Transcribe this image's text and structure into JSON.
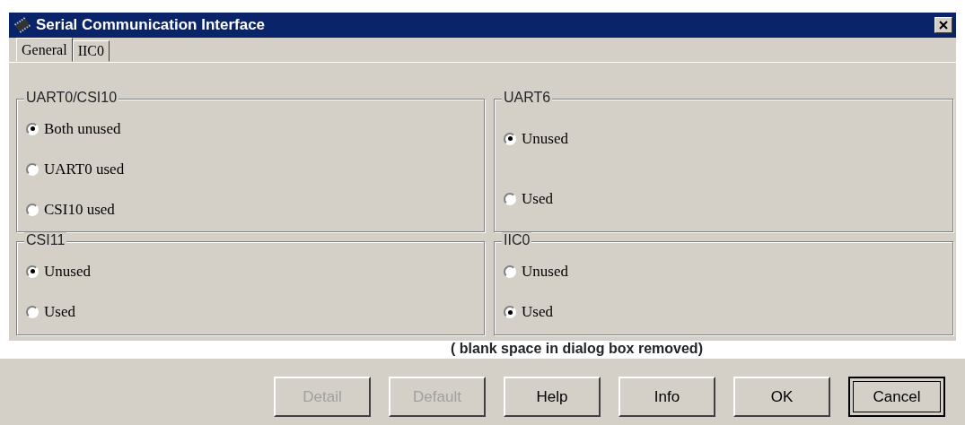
{
  "window": {
    "title": "Serial Communication Interface"
  },
  "tabs": [
    {
      "label": "General",
      "selected": true
    },
    {
      "label": "IIC0",
      "selected": false
    }
  ],
  "groups": [
    {
      "title": "UART0/CSI10",
      "options": [
        {
          "label": "Both unused",
          "selected": true
        },
        {
          "label": "UART0 used",
          "selected": false
        },
        {
          "label": "CSI10 used",
          "selected": false
        }
      ]
    },
    {
      "title": "UART6",
      "options": [
        {
          "label": "Unused",
          "selected": true
        },
        {
          "label": "Used",
          "selected": false
        }
      ]
    },
    {
      "title": "CSI11",
      "options": [
        {
          "label": "Unused",
          "selected": true
        },
        {
          "label": "Used",
          "selected": false
        }
      ]
    },
    {
      "title": "IIC0",
      "options": [
        {
          "label": "Unused",
          "selected": false
        },
        {
          "label": "Used",
          "selected": true
        }
      ]
    }
  ],
  "note": "( blank space in dialog box removed)",
  "buttons": [
    {
      "label": "Detail",
      "disabled": true,
      "focused": false
    },
    {
      "label": "Default",
      "disabled": true,
      "focused": false
    },
    {
      "label": "Help",
      "disabled": false,
      "focused": false
    },
    {
      "label": "Info",
      "disabled": false,
      "focused": false
    },
    {
      "label": "OK",
      "disabled": false,
      "focused": false
    },
    {
      "label": "Cancel",
      "disabled": false,
      "focused": true
    }
  ]
}
